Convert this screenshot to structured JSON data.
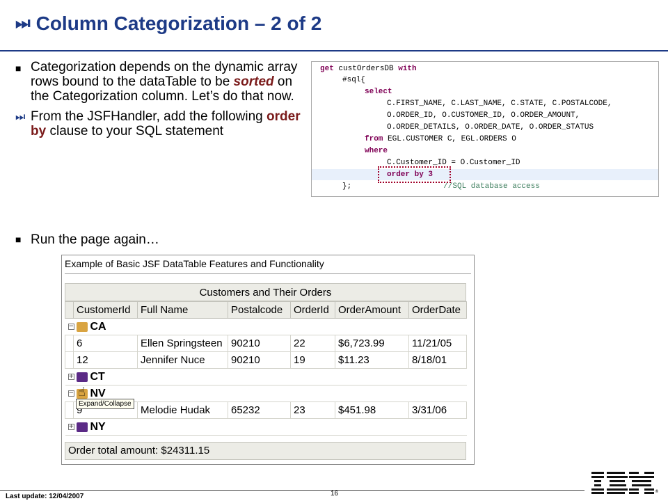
{
  "slide": {
    "title": "Column Categorization – 2 of 2",
    "title_icon": "⏭",
    "bullets": [
      {
        "parts": [
          "Categorization depends on the dynamic array rows bound to the dataTable to be ",
          "sorted",
          " on the Categorization column.  Let’s do that now."
        ]
      },
      {
        "parts": [
          "From the JSFHandler, add the following ",
          "order by",
          " clause to your SQL statement"
        ]
      }
    ],
    "run": "Run the page again…",
    "footer": {
      "last_update": "Last update: 12/04/2007",
      "page_number": "16",
      "logo": "IBM"
    }
  },
  "code": {
    "lines": [
      [
        "get",
        " custOrdersDB ",
        "with"
      ],
      [
        "#sql{"
      ],
      [
        "select"
      ],
      [
        "C.FIRST_NAME, C.LAST_NAME, C.STATE, C.POSTALCODE,"
      ],
      [
        "O.ORDER_ID, O.CUSTOMER_ID, O.ORDER_AMOUNT,"
      ],
      [
        "O.ORDER_DETAILS, O.ORDER_DATE, O.ORDER_STATUS"
      ],
      [
        "from",
        " EGL.CUSTOMER C, EGL.ORDERS O"
      ],
      [
        "where"
      ],
      [
        "C.Customer_ID = O.Customer_ID"
      ],
      [
        "order by 3"
      ],
      [
        "};",
        "//SQL database access"
      ]
    ]
  },
  "datatable": {
    "page_title": "Example of Basic JSF DataTable Features and Functionality",
    "caption": "Customers and Their Orders",
    "columns": [
      "CustomerId",
      "Full Name",
      "Postalcode",
      "OrderId",
      "OrderAmount",
      "OrderDate"
    ],
    "groups": [
      {
        "label": "CA",
        "toggle": "−",
        "rows": [
          [
            "6",
            "Ellen Springsteen",
            "90210",
            "22",
            "$6,723.99",
            "11/21/05"
          ],
          [
            "12",
            "Jennifer Nuce",
            "90210",
            "19",
            "$11.23",
            "8/18/01"
          ]
        ]
      },
      {
        "label": "CT",
        "toggle": "+",
        "rows": []
      },
      {
        "label": "NV",
        "toggle": "−",
        "rows": [
          [
            "9",
            "Melodie Hudak",
            "65232",
            "23",
            "$451.98",
            "3/31/06"
          ]
        ]
      },
      {
        "label": "NY",
        "toggle": "+",
        "rows": []
      }
    ],
    "tooltip": "Expand/Collapse",
    "total": "Order total amount: $24311.15"
  }
}
